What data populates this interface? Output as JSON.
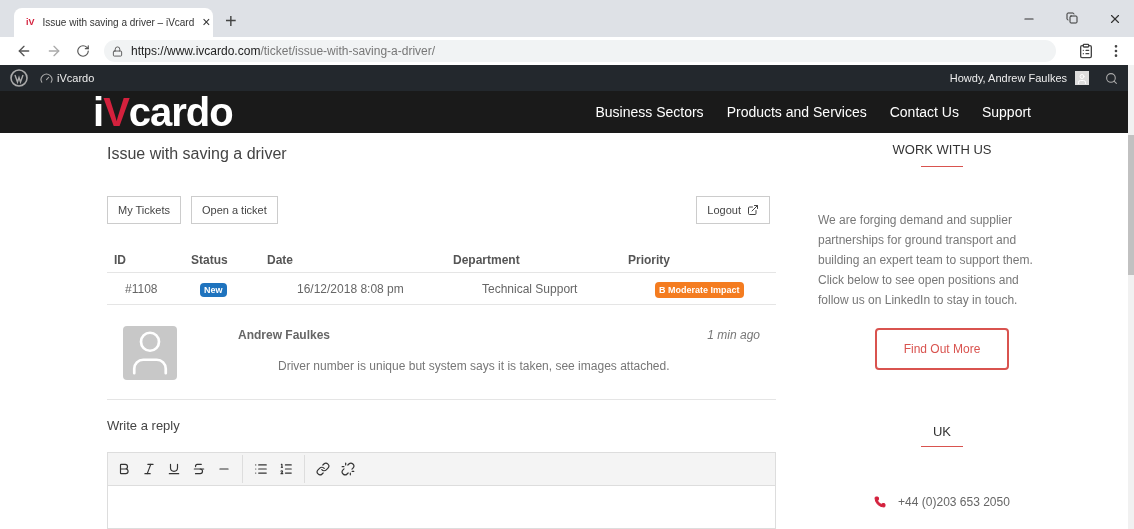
{
  "browser": {
    "tab": {
      "favicon": "iV",
      "title": "Issue with saving a driver – iVcard",
      "close": "×"
    },
    "new_tab": "+",
    "url_host": "https://www.ivcardo.com",
    "url_path": "/ticket/issue-with-saving-a-driver/"
  },
  "admin_bar": {
    "site": "iVcardo",
    "greeting": "Howdy, Andrew Faulkes"
  },
  "header": {
    "logo": [
      {
        "text": "i",
        "accent": false
      },
      {
        "text": "V",
        "accent": true
      },
      {
        "text": "cardo",
        "accent": false
      }
    ],
    "nav": [
      "Business Sectors",
      "Products and Services",
      "Contact Us",
      "Support"
    ]
  },
  "page": {
    "title": "Issue with saving a driver",
    "buttons": [
      "My Tickets",
      "Open a ticket"
    ],
    "logout": "Logout",
    "table": {
      "columns": [
        "ID",
        "Status",
        "Date",
        "Department",
        "Priority"
      ],
      "rows": [
        {
          "id": "#1108",
          "status": "New",
          "date": "16/12/2018 8:08 pm",
          "department": "Technical Support",
          "priority": "B Moderate Impact"
        }
      ]
    },
    "message": {
      "author": "Andrew Faulkes",
      "time": "1 min ago",
      "text": "Driver number is unique but system says it is taken, see images attached."
    },
    "reply_heading": "Write a reply"
  },
  "sidebar": {
    "heading": "WORK WITH US",
    "text": "We are forging demand and supplier partnerships for ground transport and building an expert team to support them. Click below to see open positions and follow us on LinkedIn to stay in touch.",
    "button": "Find Out More",
    "region": "UK",
    "phone": "+44 (0)203 653 2050"
  }
}
